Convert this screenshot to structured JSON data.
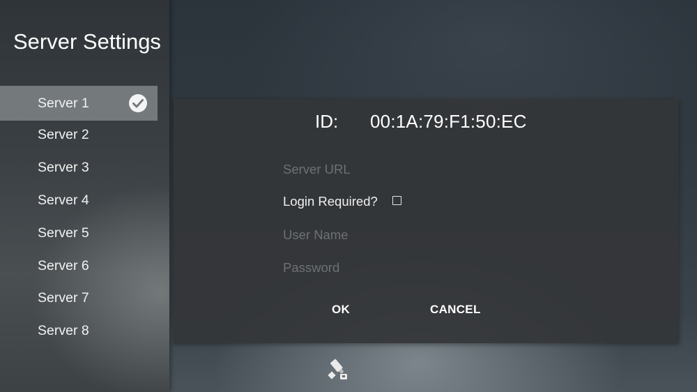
{
  "sidebar": {
    "title": "Server Settings",
    "items": [
      {
        "label": "Server 1",
        "selected": true
      },
      {
        "label": "Server 2"
      },
      {
        "label": "Server 3"
      },
      {
        "label": "Server 4"
      },
      {
        "label": "Server 5"
      },
      {
        "label": "Server 6"
      },
      {
        "label": "Server 7"
      },
      {
        "label": "Server 8"
      }
    ],
    "selected_icon": "check-circle-icon"
  },
  "dialog": {
    "id_label": "ID:",
    "id_value": "00:1A:79:F1:50:EC",
    "server_url_placeholder": "Server URL",
    "login_required_label": "Login Required?",
    "login_required_checked": false,
    "username_placeholder": "User Name",
    "password_placeholder": "Password",
    "ok_label": "OK",
    "cancel_label": "CANCEL"
  },
  "footer": {
    "icon": "usb-drive-icon"
  },
  "colors": {
    "selected_item_bg": "#74797c",
    "text": "#ffffff",
    "placeholder": "#6e7174"
  }
}
